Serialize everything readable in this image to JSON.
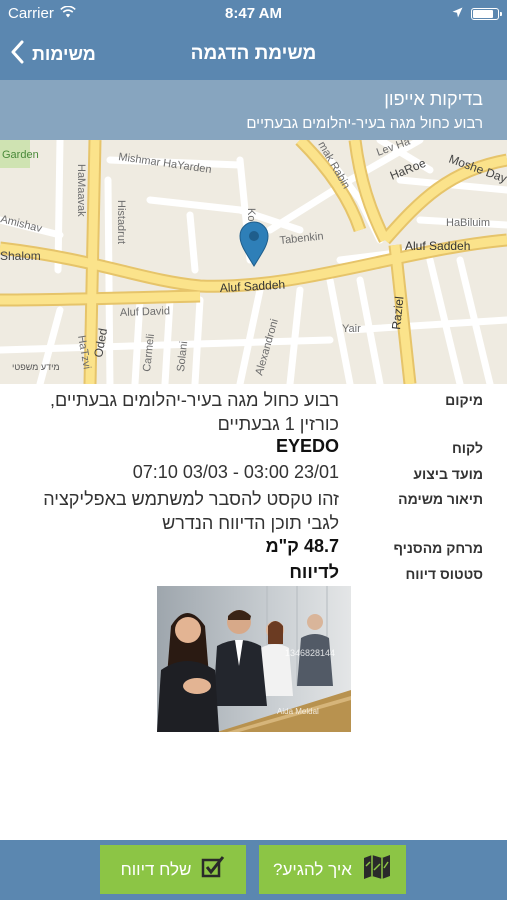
{
  "status_bar": {
    "carrier": "Carrier",
    "time": "8:47 AM",
    "battery_level": 0.9
  },
  "nav": {
    "back_label": "משימות",
    "title": "משימת הדגמה"
  },
  "header": {
    "title": "בדיקות אייפון",
    "subtitle": "רבוע כחול מגה בעיר-יהלומים גבעתיים"
  },
  "map": {
    "pin_icon": "map-pin-icon",
    "attribution": "מידע משפטי",
    "street_labels": [
      "Garden",
      "Mishmar HaYarden",
      "HaMaavak",
      "Histadrut",
      "Amishav",
      "Shalom",
      "Tabenkin",
      "Aluf Saddeh",
      "Aluf Saddeh",
      "Aluf David",
      "HaTzvi",
      "Oded",
      "Carmeli",
      "Solani",
      "Alexandroni",
      "Yair",
      "Raziel",
      "HaBiluim",
      "HaRoe",
      "Lev Ha",
      "Moshe Day",
      "Ko",
      "mak Rabin"
    ]
  },
  "details": [
    {
      "label": "מיקום",
      "value": [
        "רבוע כחול מגה בעיר-יהלומים גבעתיים,",
        "כורזין 1 גבעתיים"
      ]
    },
    {
      "label": "לקוח",
      "value": [
        "EYEDO"
      ]
    },
    {
      "label": "מועד ביצוע",
      "value": [
        "23/01 03:00 - 03/03 07:10"
      ]
    },
    {
      "label": "תיאור משימה",
      "value": [
        "זהו טקסט להסבר למשתמש באפליקציה",
        "לגבי תוכן הדיווח הנדרש"
      ]
    },
    {
      "label": "מרחק מהסניף",
      "value": [
        "48.7 ק\"מ"
      ]
    },
    {
      "label": "סטטוס דיווח",
      "value": [
        "לדיווח"
      ]
    }
  ],
  "photo": {
    "watermark_text": "Aida Meldal",
    "number_text": "1346828144"
  },
  "buttons": {
    "send_report": "שלח דיווח",
    "send_report_icon": "checkbox-icon",
    "how_to_get": "איך להגיע?",
    "how_to_get_icon": "map-icon"
  },
  "colors": {
    "nav": "#5b87b0",
    "header_band": "#87a5bf",
    "button": "#8cc545"
  }
}
